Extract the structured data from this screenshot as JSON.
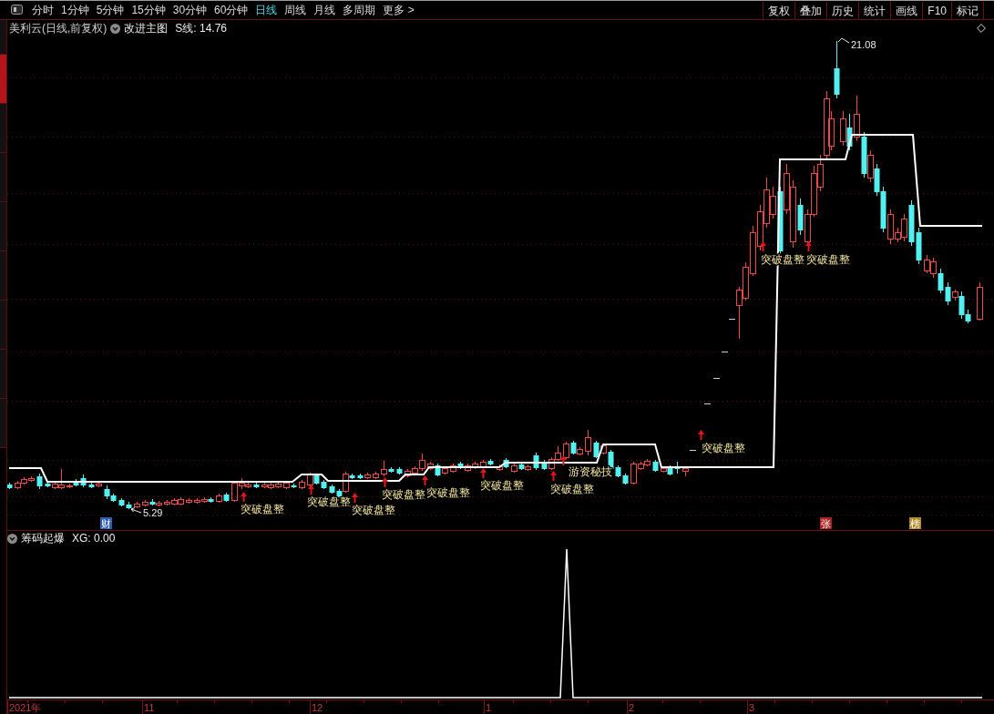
{
  "toolbar": {
    "periods": [
      {
        "label": "分时",
        "selected": false
      },
      {
        "label": "1分钟",
        "selected": false
      },
      {
        "label": "5分钟",
        "selected": false
      },
      {
        "label": "15分钟",
        "selected": false
      },
      {
        "label": "30分钟",
        "selected": false
      },
      {
        "label": "60分钟",
        "selected": false
      },
      {
        "label": "日线",
        "selected": true
      },
      {
        "label": "周线",
        "selected": false
      },
      {
        "label": "月线",
        "selected": false
      },
      {
        "label": "多周期",
        "selected": false
      },
      {
        "label": "更多 >",
        "selected": false
      }
    ],
    "actions": [
      "复权",
      "叠加",
      "历史",
      "统计",
      "画线",
      "F10",
      "标记"
    ]
  },
  "side_tabs": [
    {
      "selected": false
    },
    {
      "selected": true
    },
    {
      "selected": false
    },
    {
      "selected": false
    },
    {
      "selected": false
    },
    {
      "selected": false
    },
    {
      "selected": false
    },
    {
      "selected": false
    },
    {
      "selected": false
    }
  ],
  "main_chart": {
    "title": "美利云(日线,前复权)",
    "indicator": "改进主图",
    "reading": "S线: 14.76",
    "high_label": "21.08",
    "low_label": "5.29",
    "signals": [
      "突破盘整",
      "突破盘整",
      "突破盘整",
      "突破盘整",
      "突破盘整",
      "突破盘整",
      "突破盘整",
      "游资秘技",
      "突破盘整",
      "突破盘整",
      "突破盘整"
    ],
    "markers": [
      {
        "text": "财",
        "color": "#2f5fb0"
      },
      {
        "text": "张",
        "color": "#b02020"
      },
      {
        "text": "榜",
        "color": "#b08a2a"
      }
    ]
  },
  "sub_chart": {
    "indicator": "筹码起爆",
    "reading": "XG: 0.00"
  },
  "time_axis": [
    "2021年",
    "11",
    "12",
    "1",
    "2",
    "3"
  ]
}
